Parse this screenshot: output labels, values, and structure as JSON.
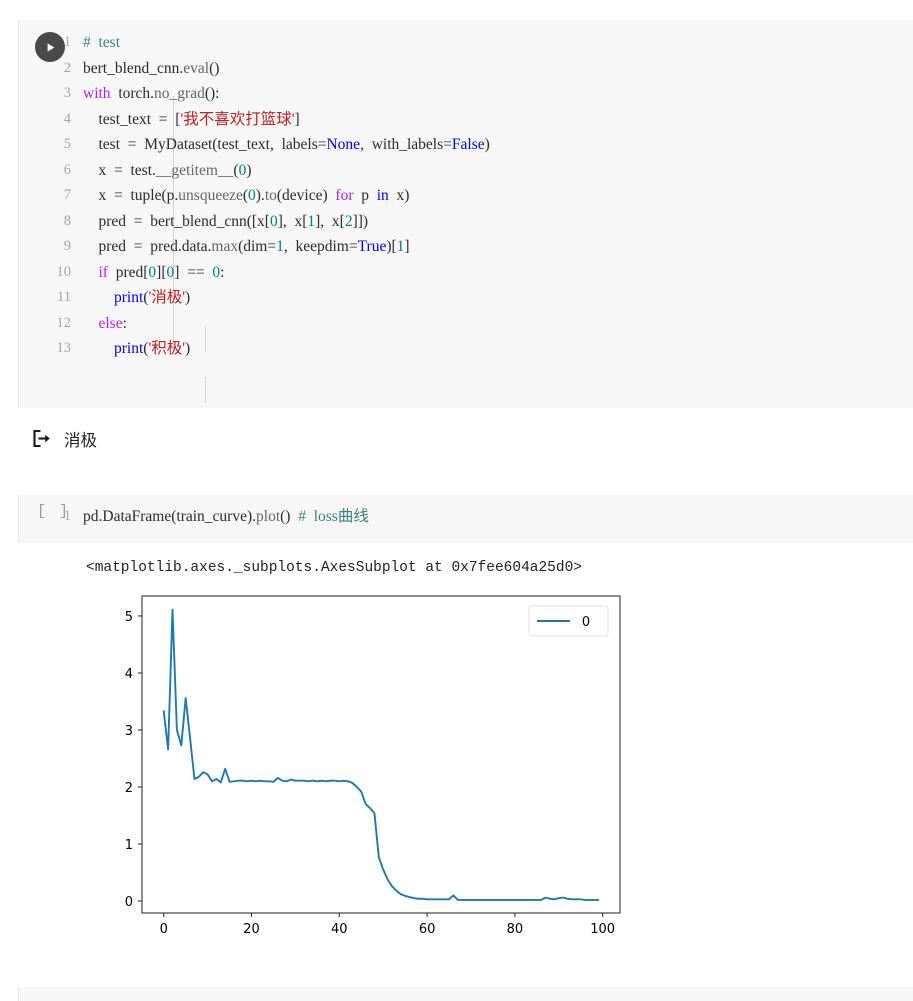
{
  "notebook": {
    "cells": [
      {
        "id": "cell-1",
        "type": "code",
        "prompt": "run",
        "lines": [
          {
            "n": "1",
            "indent": 0,
            "tokens": [
              {
                "c": "t-com",
                "t": "#  test"
              }
            ]
          },
          {
            "n": "2",
            "indent": 0,
            "tokens": [
              {
                "c": "t-plain",
                "t": "bert_blend_cnn."
              },
              {
                "c": "t-op",
                "t": "eval"
              },
              {
                "c": "t-plain",
                "t": "()"
              }
            ]
          },
          {
            "n": "3",
            "indent": 0,
            "tokens": [
              {
                "c": "t-kw",
                "t": "with"
              },
              {
                "c": "t-plain",
                "t": "  torch."
              },
              {
                "c": "t-op",
                "t": "no_grad"
              },
              {
                "c": "t-plain",
                "t": "():"
              }
            ]
          },
          {
            "n": "4",
            "indent": 1,
            "tokens": [
              {
                "c": "t-plain",
                "t": "    test_text  =  ["
              },
              {
                "c": "t-str",
                "t": "'我不喜欢打篮球'"
              },
              {
                "c": "t-plain",
                "t": "]"
              }
            ]
          },
          {
            "n": "5",
            "indent": 1,
            "tokens": [
              {
                "c": "t-plain",
                "t": "    test  =  MyDataset(test_text,  labels="
              },
              {
                "c": "t-bi",
                "t": "None"
              },
              {
                "c": "t-plain",
                "t": ",  with_labels="
              },
              {
                "c": "t-bi",
                "t": "False"
              },
              {
                "c": "t-plain",
                "t": ")"
              }
            ]
          },
          {
            "n": "6",
            "indent": 1,
            "tokens": [
              {
                "c": "t-plain",
                "t": "    x  =  test."
              },
              {
                "c": "t-op",
                "t": "__getitem__"
              },
              {
                "c": "t-plain",
                "t": "("
              },
              {
                "c": "t-num",
                "t": "0"
              },
              {
                "c": "t-plain",
                "t": ")"
              }
            ]
          },
          {
            "n": "7",
            "indent": 1,
            "tokens": [
              {
                "c": "t-plain",
                "t": "    x  =  tuple(p."
              },
              {
                "c": "t-op",
                "t": "unsqueeze"
              },
              {
                "c": "t-plain",
                "t": "("
              },
              {
                "c": "t-num",
                "t": "0"
              },
              {
                "c": "t-plain",
                "t": ")."
              },
              {
                "c": "t-op",
                "t": "to"
              },
              {
                "c": "t-plain",
                "t": "(device)  "
              },
              {
                "c": "t-kw",
                "t": "for"
              },
              {
                "c": "t-plain",
                "t": "  p  "
              },
              {
                "c": "t-bi",
                "t": "in"
              },
              {
                "c": "t-plain",
                "t": "  x)"
              }
            ]
          },
          {
            "n": "8",
            "indent": 1,
            "tokens": [
              {
                "c": "t-plain",
                "t": "    pred  =  bert_blend_cnn([x["
              },
              {
                "c": "t-num",
                "t": "0"
              },
              {
                "c": "t-plain",
                "t": "],  x["
              },
              {
                "c": "t-num",
                "t": "1"
              },
              {
                "c": "t-plain",
                "t": "],  x["
              },
              {
                "c": "t-num",
                "t": "2"
              },
              {
                "c": "t-plain",
                "t": "]])"
              }
            ]
          },
          {
            "n": "9",
            "indent": 1,
            "tokens": [
              {
                "c": "t-plain",
                "t": "    pred  =  pred.data."
              },
              {
                "c": "t-op",
                "t": "max"
              },
              {
                "c": "t-plain",
                "t": "(dim="
              },
              {
                "c": "t-num",
                "t": "1"
              },
              {
                "c": "t-plain",
                "t": ",  keepdim="
              },
              {
                "c": "t-bi",
                "t": "True"
              },
              {
                "c": "t-plain",
                "t": ")["
              },
              {
                "c": "t-num",
                "t": "1"
              },
              {
                "c": "t-plain",
                "t": "]"
              }
            ]
          },
          {
            "n": "10",
            "indent": 1,
            "tokens": [
              {
                "c": "t-plain",
                "t": "    "
              },
              {
                "c": "t-kw",
                "t": "if"
              },
              {
                "c": "t-plain",
                "t": "  pred["
              },
              {
                "c": "t-num",
                "t": "0"
              },
              {
                "c": "t-plain",
                "t": "]["
              },
              {
                "c": "t-num",
                "t": "0"
              },
              {
                "c": "t-plain",
                "t": "]  ==  "
              },
              {
                "c": "t-num",
                "t": "0"
              },
              {
                "c": "t-plain",
                "t": ":"
              }
            ]
          },
          {
            "n": "11",
            "indent": 2,
            "tokens": [
              {
                "c": "t-plain",
                "t": "        "
              },
              {
                "c": "t-bi",
                "t": "print"
              },
              {
                "c": "t-plain",
                "t": "("
              },
              {
                "c": "t-str",
                "t": "'消极'"
              },
              {
                "c": "t-plain",
                "t": ")"
              }
            ]
          },
          {
            "n": "12",
            "indent": 1,
            "tokens": [
              {
                "c": "t-plain",
                "t": "    "
              },
              {
                "c": "t-kw",
                "t": "else"
              },
              {
                "c": "t-plain",
                "t": ":"
              }
            ]
          },
          {
            "n": "13",
            "indent": 2,
            "tokens": [
              {
                "c": "t-plain",
                "t": "        "
              },
              {
                "c": "t-bi",
                "t": "print"
              },
              {
                "c": "t-plain",
                "t": "("
              },
              {
                "c": "t-str",
                "t": "'积极'"
              },
              {
                "c": "t-plain",
                "t": ")"
              }
            ]
          }
        ],
        "output": {
          "icon": "output-arrow-icon",
          "text": "消极"
        }
      },
      {
        "id": "cell-2",
        "type": "code",
        "prompt": "[ ]",
        "lines": [
          {
            "n": "1",
            "indent": 0,
            "tokens": [
              {
                "c": "t-plain",
                "t": "pd.DataFrame(train_curve)."
              },
              {
                "c": "t-op",
                "t": "plot"
              },
              {
                "c": "t-plain",
                "t": "()  "
              },
              {
                "c": "t-com",
                "t": "#  loss曲线"
              }
            ]
          }
        ],
        "output": {
          "repr": "<matplotlib.axes._subplots.AxesSubplot at 0x7fee604a25d0>"
        }
      }
    ]
  },
  "colors": {
    "cell_background": "#f7f7f7",
    "page_background": "#ffffff",
    "line_number": "#a6a6a6",
    "run_button": "#494949",
    "comment": "#408080",
    "keyword": "#aa22ff",
    "builtin": "#0000ff",
    "number": "#008080",
    "string": "#ba2121",
    "plot_line": "#1f77b4",
    "axis": "#333333"
  },
  "chart_data": {
    "type": "line",
    "title": "",
    "xlabel": "",
    "ylabel": "",
    "xlim": [
      -4.95,
      103.95
    ],
    "ylim": [
      -0.21,
      5.35
    ],
    "xticks": [
      0,
      20,
      40,
      60,
      80,
      100
    ],
    "yticks": [
      0,
      1,
      2,
      3,
      4,
      5
    ],
    "grid": false,
    "legend": {
      "position": "upper right",
      "entries": [
        "0"
      ]
    },
    "series": [
      {
        "name": "0",
        "color": "#1f77b4",
        "x": [
          0,
          1,
          2,
          3,
          4,
          5,
          6,
          7,
          8,
          9,
          10,
          11,
          12,
          13,
          14,
          15,
          16,
          17,
          18,
          19,
          20,
          21,
          22,
          23,
          24,
          25,
          26,
          27,
          28,
          29,
          30,
          31,
          32,
          33,
          34,
          35,
          36,
          37,
          38,
          39,
          40,
          41,
          42,
          43,
          44,
          45,
          46,
          47,
          48,
          49,
          50,
          51,
          52,
          53,
          54,
          55,
          56,
          57,
          58,
          59,
          60,
          61,
          62,
          63,
          64,
          65,
          66,
          67,
          68,
          69,
          70,
          71,
          72,
          73,
          74,
          75,
          76,
          77,
          78,
          79,
          80,
          81,
          82,
          83,
          84,
          85,
          86,
          87,
          88,
          89,
          90,
          91,
          92,
          93,
          94,
          95,
          96,
          97,
          98,
          99
        ],
        "values": [
          3.33,
          2.66,
          5.11,
          3.0,
          2.73,
          3.56,
          2.86,
          2.14,
          2.18,
          2.26,
          2.22,
          2.1,
          2.14,
          2.08,
          2.32,
          2.09,
          2.1,
          2.11,
          2.11,
          2.1,
          2.11,
          2.1,
          2.11,
          2.1,
          2.1,
          2.09,
          2.16,
          2.11,
          2.1,
          2.13,
          2.11,
          2.11,
          2.11,
          2.1,
          2.11,
          2.1,
          2.11,
          2.1,
          2.11,
          2.11,
          2.1,
          2.11,
          2.1,
          2.07,
          2.0,
          1.92,
          1.7,
          1.63,
          1.54,
          0.77,
          0.55,
          0.38,
          0.26,
          0.18,
          0.12,
          0.09,
          0.07,
          0.05,
          0.04,
          0.04,
          0.03,
          0.03,
          0.03,
          0.03,
          0.03,
          0.03,
          0.1,
          0.02,
          0.02,
          0.02,
          0.02,
          0.02,
          0.02,
          0.02,
          0.02,
          0.02,
          0.02,
          0.02,
          0.02,
          0.02,
          0.02,
          0.02,
          0.02,
          0.02,
          0.02,
          0.02,
          0.02,
          0.06,
          0.04,
          0.03,
          0.05,
          0.06,
          0.04,
          0.03,
          0.03,
          0.03,
          0.02,
          0.02,
          0.02,
          0.02
        ]
      }
    ]
  }
}
